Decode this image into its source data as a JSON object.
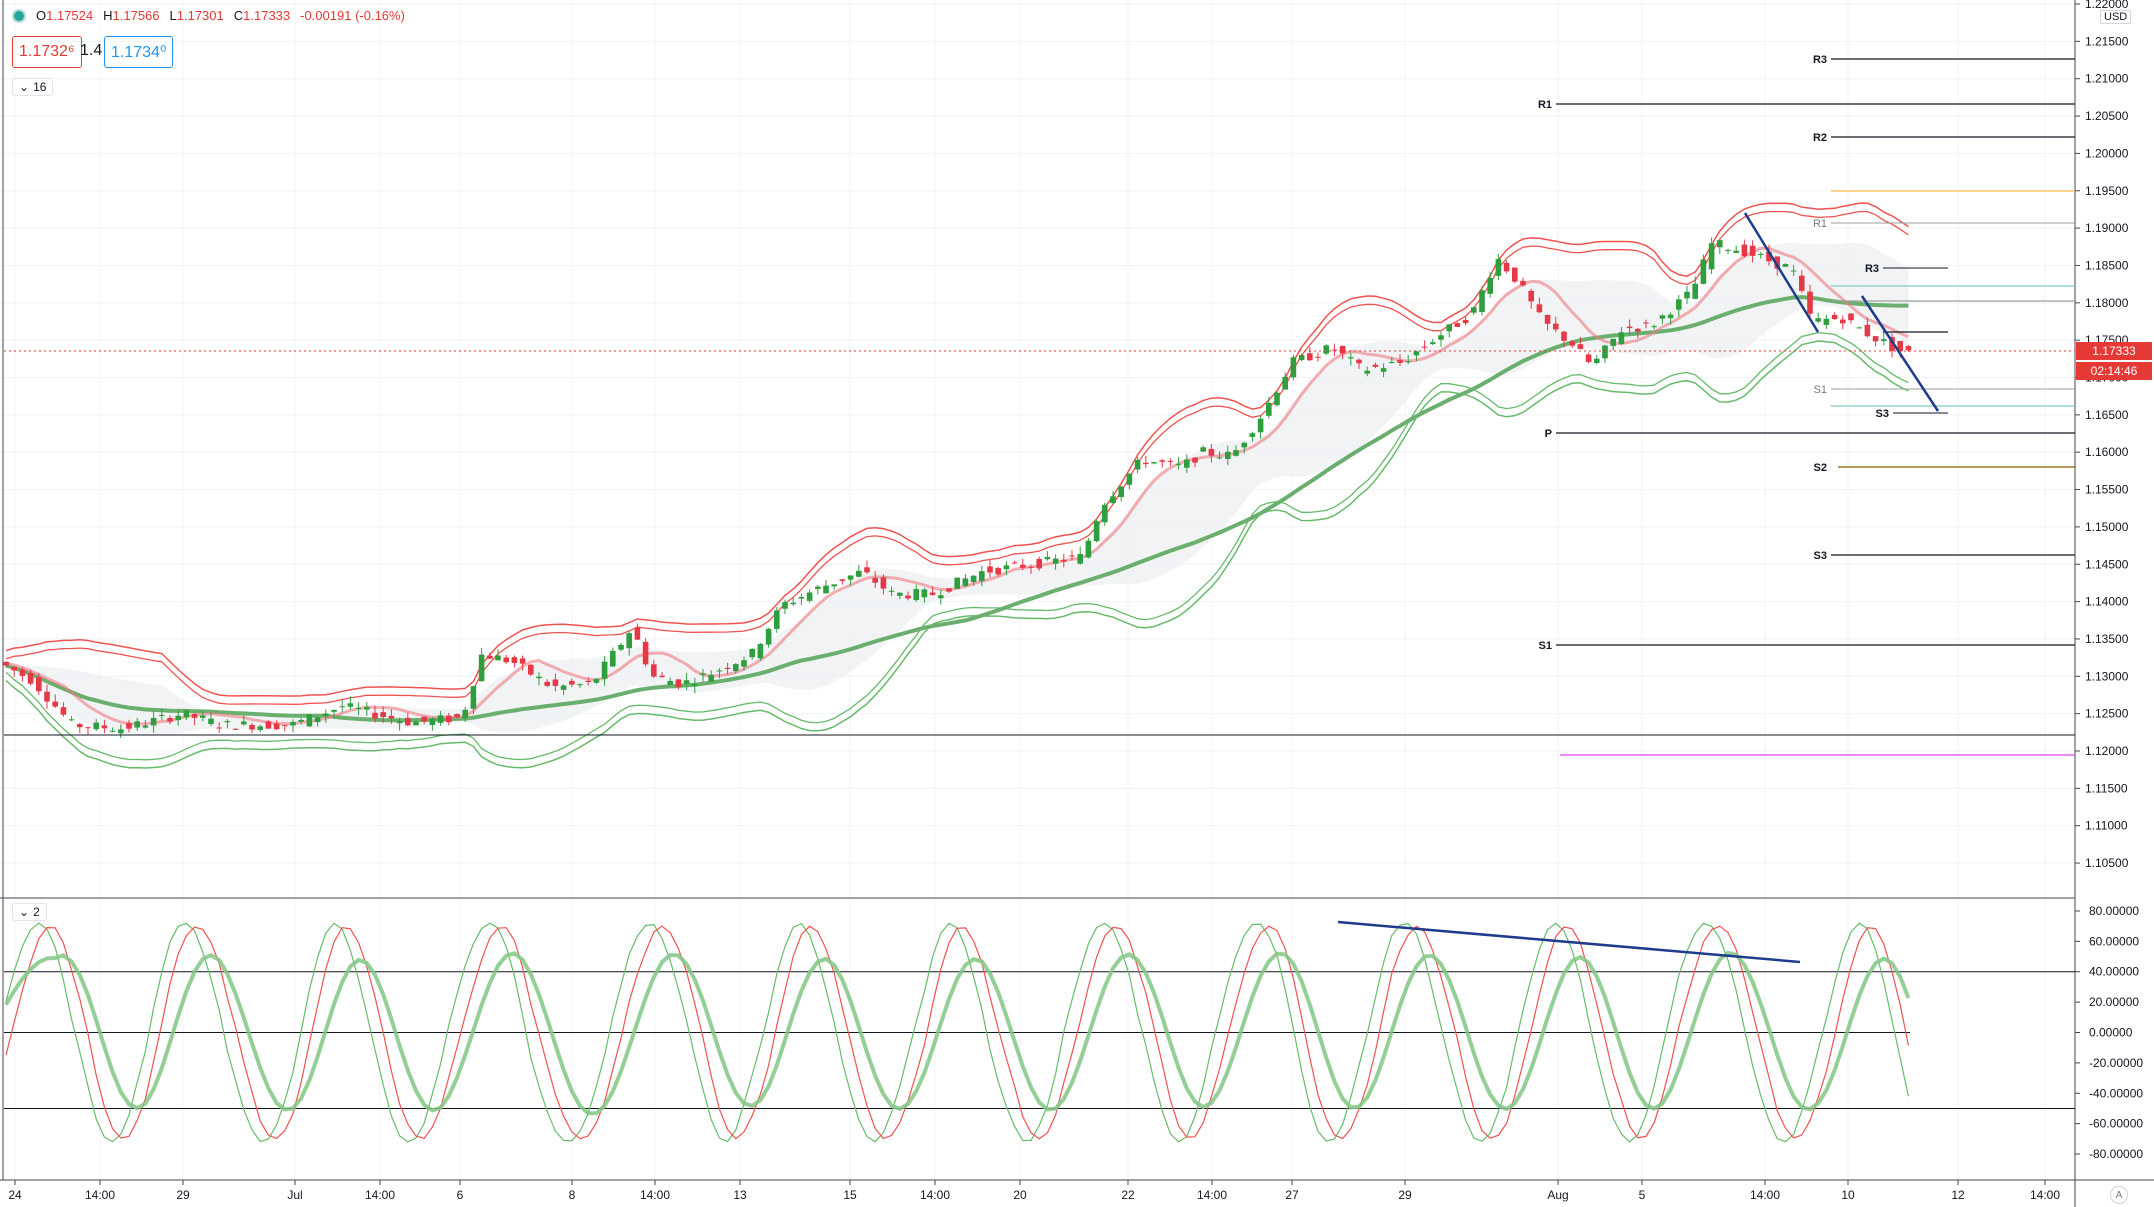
{
  "legend": {
    "open_label": "O",
    "open": "1.17524",
    "high_label": "H",
    "high": "1.17566",
    "low_label": "L",
    "low": "1.17301",
    "close_label": "C",
    "close": "1.17333",
    "change": "-0.00191 (-0.16%)"
  },
  "quote": {
    "bid": "1.1732⁶",
    "spread": "1.4",
    "ask": "1.1734⁰"
  },
  "panes": {
    "main_collapse": "16",
    "osc_collapse": "2"
  },
  "price_axis": {
    "currency": "USD",
    "ticks": [
      "1.22000",
      "1.21500",
      "1.21000",
      "1.20500",
      "1.20000",
      "1.19500",
      "1.19000",
      "1.18500",
      "1.18000",
      "1.17500",
      "1.17000",
      "1.16500",
      "1.16000",
      "1.15500",
      "1.15000",
      "1.14500",
      "1.14000",
      "1.13500",
      "1.13000",
      "1.12500",
      "1.12000",
      "1.11500",
      "1.11000",
      "1.10500"
    ],
    "current_price": "1.17333",
    "countdown": "02:14:46"
  },
  "osc_axis": {
    "ticks": [
      "80.00000",
      "60.00000",
      "40.00000",
      "20.00000",
      "0.00000",
      "-20.00000",
      "-40.00000",
      "-60.00000",
      "-80.00000"
    ]
  },
  "time_axis": {
    "labels": [
      "24",
      "14:00",
      "29",
      "Jul",
      "14:00",
      "6",
      "8",
      "14:00",
      "13",
      "15",
      "14:00",
      "20",
      "22",
      "14:00",
      "27",
      "29",
      "Aug",
      "5",
      "14:00",
      "10",
      "12",
      "14:00"
    ]
  },
  "pivots_large": [
    {
      "label": "R3"
    },
    {
      "label": "R1"
    },
    {
      "label": "R2"
    },
    {
      "label": "P"
    },
    {
      "label": "S2"
    },
    {
      "label": "S3"
    },
    {
      "label": "S1"
    }
  ],
  "pivots_small": [
    {
      "label": "R1"
    },
    {
      "label": "R3"
    },
    {
      "label": "S1"
    },
    {
      "label": "S3"
    }
  ],
  "auto_label": "A",
  "colors": {
    "bull": "#2e9e3e",
    "bear": "#e53946",
    "bb_upper": "#ef5350",
    "bb_lower": "#66bb6a",
    "trend": "#1e3c8c",
    "cur_price": "#e53935",
    "grid": "#f0f3fa"
  }
}
